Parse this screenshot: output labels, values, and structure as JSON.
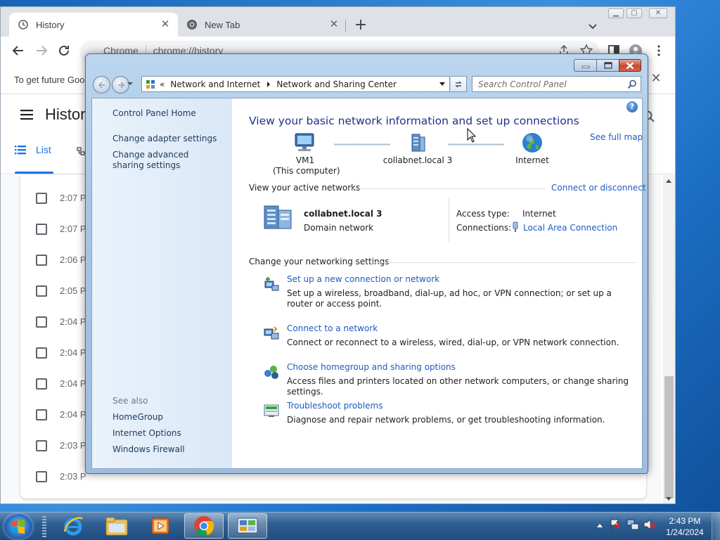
{
  "chrome": {
    "tabs": [
      {
        "label": "History",
        "icon": "history-icon",
        "active": true
      },
      {
        "label": "New Tab",
        "icon": "chrome-icon",
        "active": false
      }
    ],
    "omnibox": {
      "site_label": "Chrome",
      "url": "chrome://history"
    },
    "infobar_text": "To get future Goo",
    "page_title": "Histor",
    "history_tab": "List",
    "history_times": [
      "2:07 P",
      "2:07 P",
      "2:06 P",
      "2:05 P",
      "2:04 P",
      "2:04 P",
      "2:04 P",
      "2:04 P",
      "2:03 P",
      "2:03 P"
    ]
  },
  "control_panel": {
    "breadcrumb": [
      "Network and Internet",
      "Network and Sharing Center"
    ],
    "breadcrumb_overflow": "«",
    "search_placeholder": "Search Control Panel",
    "left_pane": {
      "links": [
        "Control Panel Home",
        "Change adapter settings",
        "Change advanced sharing settings"
      ],
      "see_also_label": "See also",
      "see_also": [
        "HomeGroup",
        "Internet Options",
        "Windows Firewall"
      ]
    },
    "main_title": "View your basic network information and set up connections",
    "see_full_map": "See full map",
    "map": {
      "computer_name": "VM1",
      "computer_sub": "(This computer)",
      "network": "collabnet.local  3",
      "internet": "Internet"
    },
    "active_networks": {
      "header": "View your active networks",
      "connect_link": "Connect or disconnect",
      "network_name": "collabnet.local  3",
      "network_type": "Domain network",
      "access_type_label": "Access type:",
      "access_type_value": "Internet",
      "connections_label": "Connections:",
      "connections_value": "Local Area Connection"
    },
    "settings_header": "Change your networking settings",
    "tasks": [
      {
        "title": "Set up a new connection or network",
        "desc": "Set up a wireless, broadband, dial-up, ad hoc, or VPN connection; or set up a router or access point.",
        "icon": "new-connection-icon"
      },
      {
        "title": "Connect to a network",
        "desc": "Connect or reconnect to a wireless, wired, dial-up, or VPN network connection.",
        "icon": "connect-network-icon"
      },
      {
        "title": "Choose homegroup and sharing options",
        "desc": "Access files and printers located on other network computers, or change sharing settings.",
        "icon": "homegroup-icon"
      },
      {
        "title": "Troubleshoot problems",
        "desc": "Diagnose and repair network problems, or get troubleshooting information.",
        "icon": "troubleshoot-icon"
      }
    ]
  },
  "taskbar": {
    "time": "2:43 PM",
    "date": "1/24/2024",
    "apps": [
      "internet-explorer-icon",
      "windows-explorer-icon",
      "media-player-icon",
      "chrome-icon",
      "control-panel-icon"
    ]
  }
}
